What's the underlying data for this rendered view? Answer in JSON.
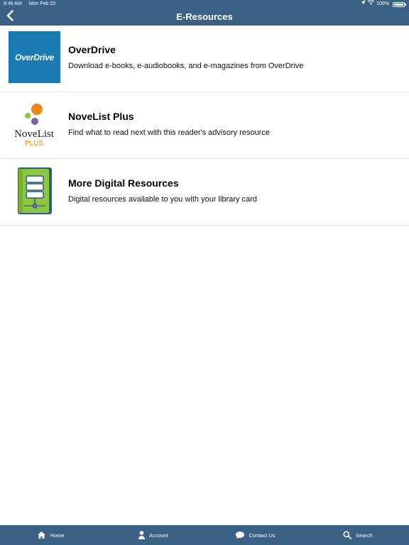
{
  "status_bar": {
    "time": "9:46 AM",
    "date": "Mon Feb 20",
    "battery": "100%",
    "icons": [
      "location-arrow-icon",
      "wifi-icon",
      "battery-icon"
    ]
  },
  "nav": {
    "title": "E-Resources",
    "back_icon": "chevron-left-icon"
  },
  "resources": [
    {
      "title": "OverDrive",
      "description": "Download e-books, e-audiobooks, and e-magazines from OverDrive",
      "logo_text": "OverDrive"
    },
    {
      "title": "NoveList Plus",
      "description": "Find what to read next with this reader's advisory resource",
      "logo_text": "NoveList",
      "logo_subtext": "PLUS"
    },
    {
      "title": "More Digital Resources",
      "description": "Digital resources available to you with your library card",
      "logo_icon": "digital-book-icon"
    }
  ],
  "tabs": [
    {
      "label": "Home",
      "icon": "home-icon"
    },
    {
      "label": "Account",
      "icon": "person-icon"
    },
    {
      "label": "Contact Us",
      "icon": "chat-bubble-icon"
    },
    {
      "label": "Search",
      "icon": "search-icon"
    }
  ],
  "colors": {
    "bar": "#3b6184",
    "overdrive_blue": "#1a7ab1",
    "novelist_orange": "#e88a1a",
    "novelist_green": "#8dc63f",
    "novelist_purple": "#7b5ea7"
  }
}
